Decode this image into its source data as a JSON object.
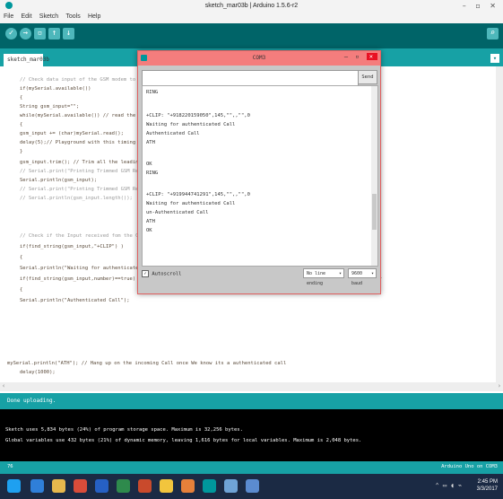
{
  "window": {
    "title": "sketch_mar03b | Arduino 1.5.6-r2",
    "controls": "– ▫ ✕"
  },
  "menu": [
    "File",
    "Edit",
    "Sketch",
    "Tools",
    "Help"
  ],
  "toolbar": {
    "verify": "✓",
    "upload": "→",
    "new": "▫",
    "open": "↑",
    "save": "↓",
    "serial": "⌕"
  },
  "tab": {
    "name": "sketch_mar03b",
    "arrow": "▾"
  },
  "code": [
    "// Check data input of the GSM modem to identify",
    "if(mySerial.available())",
    "{",
    "  String gsm_input=\"\";",
    "  while(mySerial.available()) // read the data",
    "  {",
    "    gsm_input += (char)mySerial.read();",
    "    delay(5);// Playground with this timing if",
    "  }",
    "  gsm_input.trim(); // Trim all the leading / t",
    "// Serial.print(\"Printing Trimmed GSM Response",
    "  Serial.println(gsm_input);",
    "// Serial.print(\"Printing Trimmed GSM Response",
    "// Serial.println(gsm_input.length());",
    "",
    "// Check if the Input received fom the GSM mo",
    "  if(find_string(gsm_input,\"+CLIP\") )",
    "  {",
    "    Serial.println(\"Waiting for authenticated C",
    "    if(find_string(gsm_input,number)==true) // Check if the Input received fom the GSM modem contains the Authenticated Number",
    "    {",
    "      Serial.println(\"Authenticated Call\");",
    "",
    "",
    "",
    "mySerial.println(\"ATH\"); // Hang up on the incoming Call once We know its a authenticated call",
    "      delay(1000);"
  ],
  "status": "Done uploading.",
  "console": [
    "Sketch uses 5,834 bytes (24%) of program storage space. Maximum is 32,256 bytes.",
    "Global variables use 432 bytes (21%) of dynamic memory, leaving 1,616 bytes for local variables. Maximum is 2,048 bytes."
  ],
  "footer": {
    "line": "76",
    "board": "Arduino Uno on COM3"
  },
  "serial_monitor": {
    "title": "COM3",
    "controls": "–  ▫",
    "close": "✕",
    "input_value": "",
    "send": "Send",
    "output": [
      "RING",
      "",
      "+CLIP: \"+918220159050\",145,\"\",,\"\",0",
      "Waiting for authenticated Call",
      "Authenticated Call",
      "ATH",
      "",
      "OK",
      "RING",
      "",
      "+CLIP: \"+919944741291\",145,\"\",,\"\",0",
      "Waiting for authenticated Call",
      "un-Authenticated Call",
      "ATH",
      "OK"
    ],
    "autoscroll_label": "Autoscroll",
    "autoscroll_checked": true,
    "line_ending": "No line ending",
    "baud": "9600 baud"
  },
  "taskbar": {
    "time": "2:45 PM",
    "date": "3/3/2017"
  },
  "colors": {
    "teal_dark": "#006468",
    "teal": "#17a1a5",
    "serial_title": "#f47d7d"
  }
}
